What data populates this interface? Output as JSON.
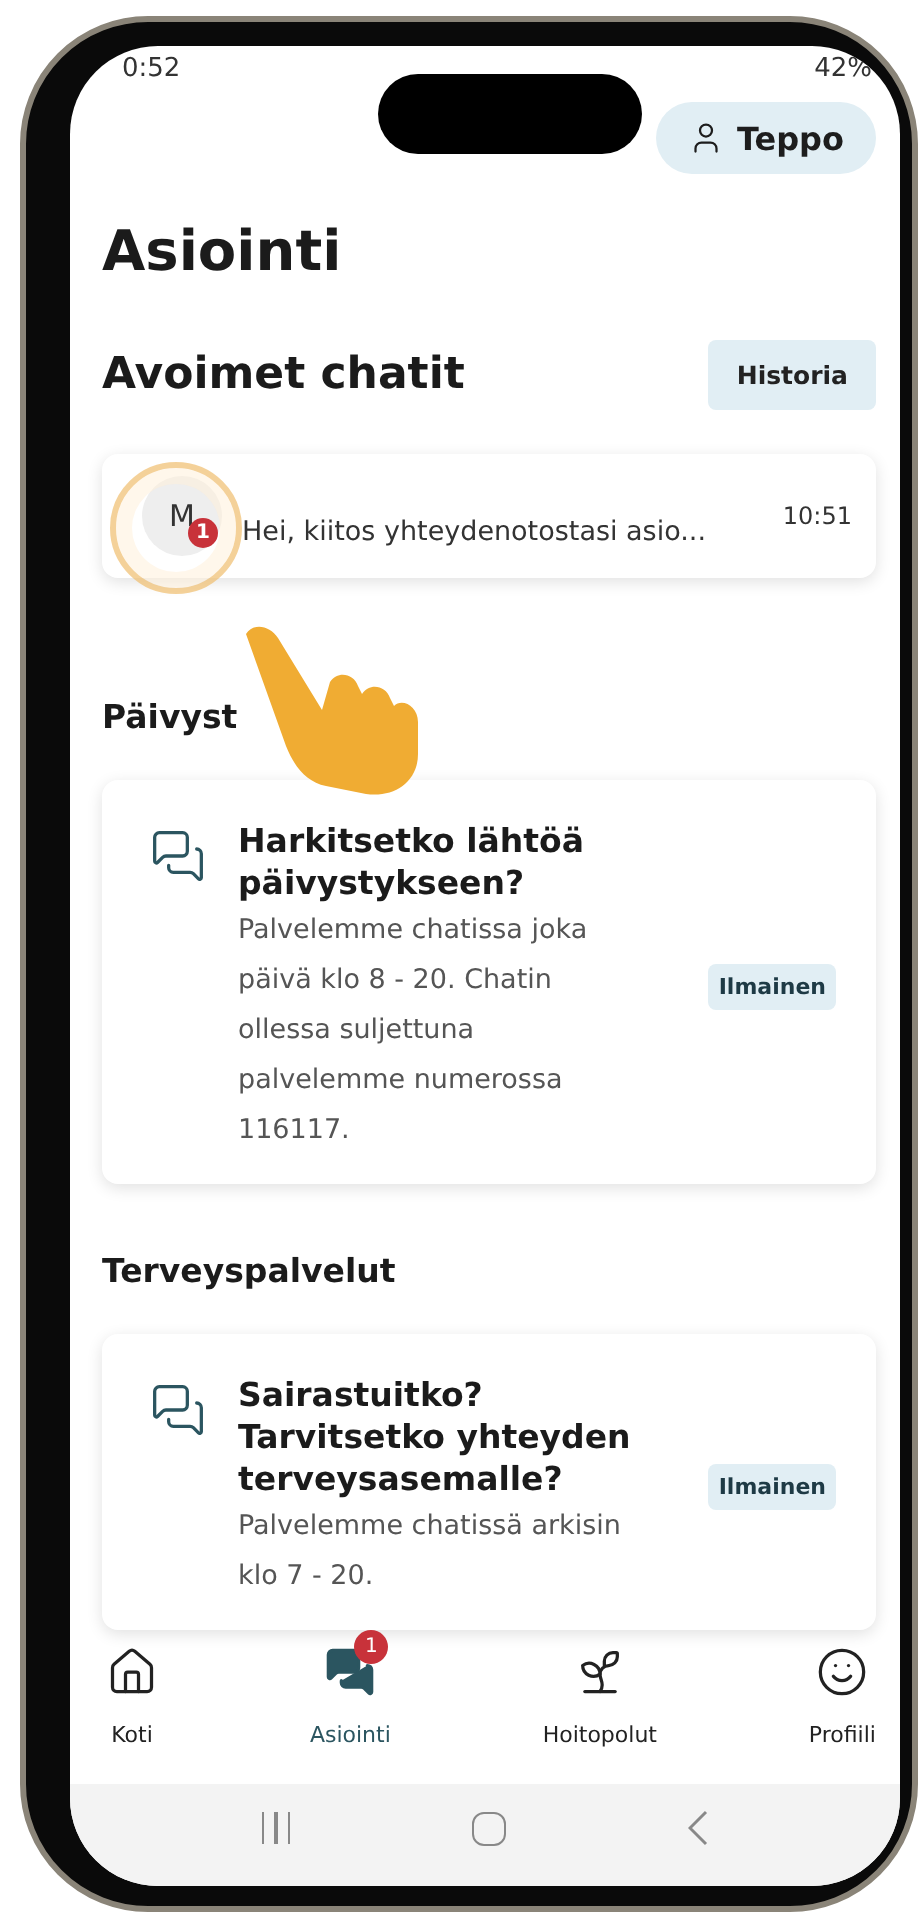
{
  "status_bar": {
    "time": "0:52",
    "battery": "42%"
  },
  "account_button": {
    "label": "Teppo"
  },
  "title": "Asiointi",
  "open_chats": {
    "heading": "Avoimet chatit",
    "history_button": "Historia",
    "chats": [
      {
        "avatar": "M",
        "unread": "1",
        "preview": "Hei, kiitos yhteydenotostasi asio...",
        "time": "10:51"
      }
    ]
  },
  "sections": [
    {
      "heading": "Päivyst",
      "services": [
        {
          "title": "Harkitsetko lähtöä päivystykseen?",
          "description": "Palvelemme chatissa joka päivä klo 8 - 20. Chatin ollessa suljettuna palvelemme numerossa 116117.",
          "tag": "Ilmainen"
        }
      ]
    },
    {
      "heading": "Terveyspalvelut",
      "services": [
        {
          "title": "Sairastuitko? Tarvitsetko yhteyden terveysasemalle?",
          "description": "Palvelemme chatissä arkisin klo 7 - 20.",
          "tag": "Ilmainen"
        }
      ]
    }
  ],
  "tab_bar": [
    {
      "label": "Koti",
      "selected": false
    },
    {
      "label": "Asiointi",
      "selected": true,
      "badge": "1"
    },
    {
      "label": "Hoitopolut",
      "selected": false
    },
    {
      "label": "Profiili",
      "selected": false
    }
  ]
}
